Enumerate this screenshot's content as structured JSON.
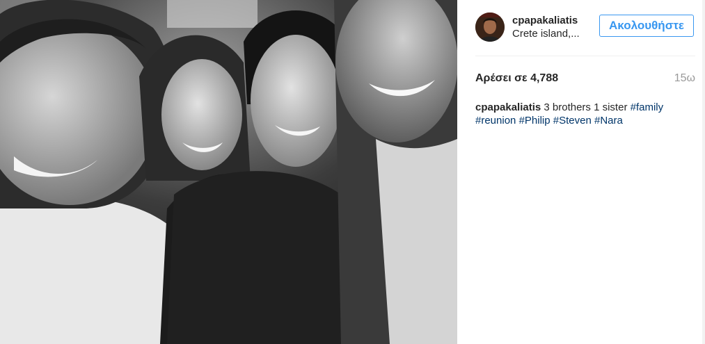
{
  "post": {
    "photo_alt": "",
    "author": {
      "username": "cpapakaliatis",
      "location": "Crete island,..."
    },
    "follow_label": "Ακολουθήστε",
    "likes_text": "Αρέσει σε 4,788",
    "time_text": "15ω",
    "caption": {
      "username": "cpapakaliatis",
      "text": "3 brothers 1 sister",
      "hashtags": [
        "#family",
        "#reunion",
        "#Philip",
        "#Steven",
        "#Nara"
      ]
    }
  },
  "colors": {
    "accent": "#3897f0",
    "hashtag": "#003569",
    "muted": "#999999"
  }
}
